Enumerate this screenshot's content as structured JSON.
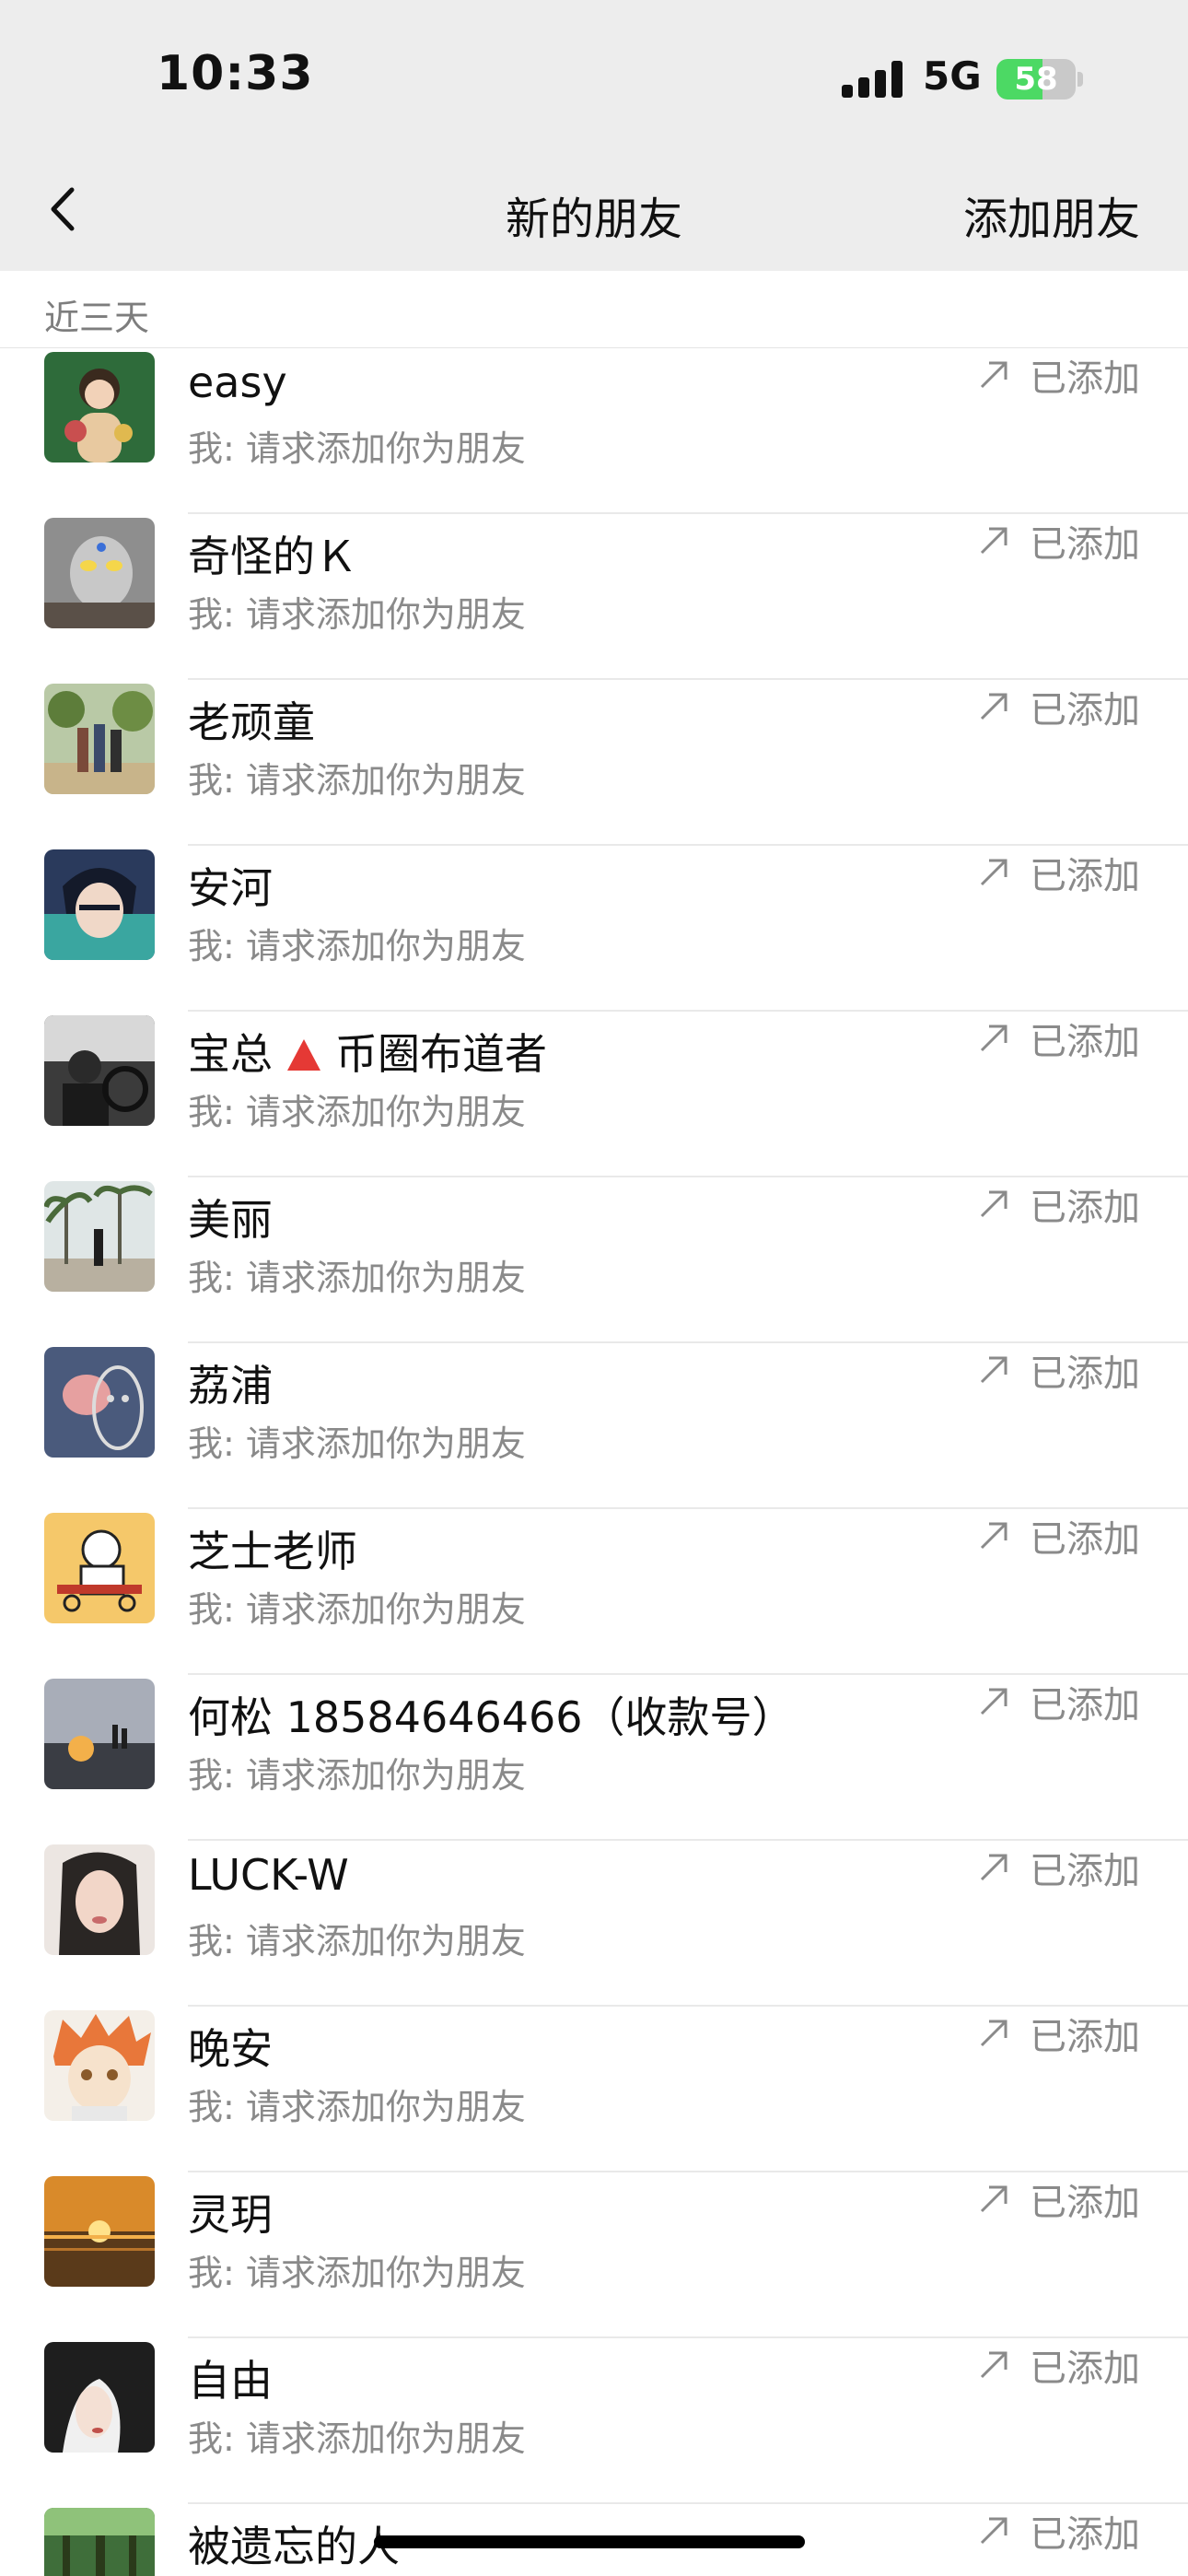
{
  "status_bar": {
    "time": "10:33",
    "network": "5G",
    "battery": "58",
    "battery_level": 0.58,
    "battery_color": "#4cd964"
  },
  "nav": {
    "back_icon": "chevron-left-icon",
    "title": "新的朋友",
    "add_friend": "添加朋友"
  },
  "section": {
    "title": "近三天"
  },
  "status_label": "已添加",
  "status_icon": "arrow-up-right-icon",
  "requests": [
    {
      "name": "easy",
      "message": "我: 请求添加你为朋友",
      "avatar_color": "#2e6b3a"
    },
    {
      "name": "奇怪的Ｋ",
      "message": "我: 请求添加你为朋友",
      "avatar_color": "#8e8e8e"
    },
    {
      "name": "老顽童",
      "message": "我: 请求添加你为朋友",
      "avatar_color": "#9fae7c"
    },
    {
      "name": "安河",
      "message": "我: 请求添加你为朋友",
      "avatar_color": "#2a3a5c"
    },
    {
      "name_prefix": "宝总",
      "name_suffix": "币圈布道者",
      "flag_icon": "red-triangle-icon",
      "message": "我: 请求添加你为朋友",
      "avatar_color": "#3b3b3b"
    },
    {
      "name": "美丽",
      "message": "我: 请求添加你为朋友",
      "avatar_color": "#7c9c8c"
    },
    {
      "name": "荔浦",
      "message": "我: 请求添加你为朋友",
      "avatar_color": "#5c6c8c"
    },
    {
      "name": "芝士老师",
      "message": "我: 请求添加你为朋友",
      "avatar_color": "#f5c86a"
    },
    {
      "name": "何松 18584646466（收款号）",
      "message": "我: 请求添加你为朋友",
      "avatar_color": "#8a8f9c"
    },
    {
      "name": "LUCK-W",
      "message": "我: 请求添加你为朋友",
      "avatar_color": "#d9c2b8"
    },
    {
      "name": "晚安",
      "message": "我: 请求添加你为朋友",
      "avatar_color": "#e8773a"
    },
    {
      "name": "灵玥",
      "message": "我: 请求添加你为朋友",
      "avatar_color": "#d98a2a"
    },
    {
      "name": "自由",
      "message": "我: 请求添加你为朋友",
      "avatar_color": "#1e1e1e"
    },
    {
      "name": "被遗忘的人",
      "message": "",
      "avatar_color": "#3f6e3a"
    }
  ]
}
